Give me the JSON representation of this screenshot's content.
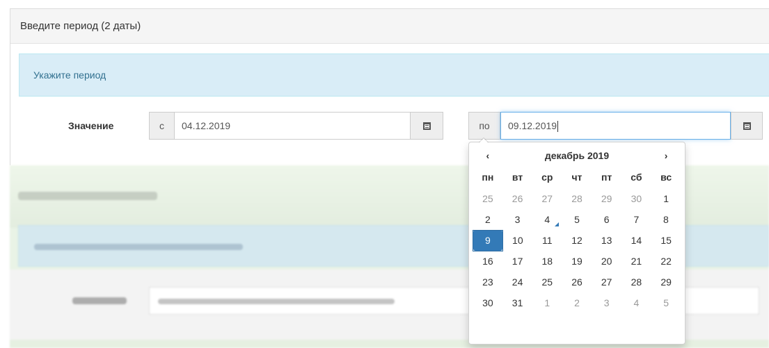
{
  "panel": {
    "title": "Введите период (2 даты)",
    "info_message": "Укажите период"
  },
  "period_field": {
    "label": "Значение",
    "from_prefix": "с",
    "from_value": "04.12.2019",
    "to_prefix": "по",
    "to_value": "09.12.2019"
  },
  "datepicker": {
    "prev_icon": "chevron-left-icon",
    "next_icon": "chevron-right-icon",
    "prev_label": "‹",
    "next_label": "›",
    "month_title": "декабрь 2019",
    "weekdays": [
      "пн",
      "вт",
      "ср",
      "чт",
      "пт",
      "сб",
      "вс"
    ],
    "weeks": [
      [
        "25",
        "26",
        "27",
        "28",
        "29",
        "30",
        "1"
      ],
      [
        "2",
        "3",
        "4",
        "5",
        "6",
        "7",
        "8"
      ],
      [
        "9",
        "10",
        "11",
        "12",
        "13",
        "14",
        "15"
      ],
      [
        "16",
        "17",
        "18",
        "19",
        "20",
        "21",
        "22"
      ],
      [
        "23",
        "24",
        "25",
        "26",
        "27",
        "28",
        "29"
      ],
      [
        "30",
        "31",
        "1",
        "2",
        "3",
        "4",
        "5"
      ]
    ],
    "today": "4",
    "selected": "9",
    "accent_color": "#337ab7"
  },
  "colors": {
    "info_background": "#d9edf7",
    "info_text": "#31708f",
    "focus_border": "#66afe9"
  }
}
